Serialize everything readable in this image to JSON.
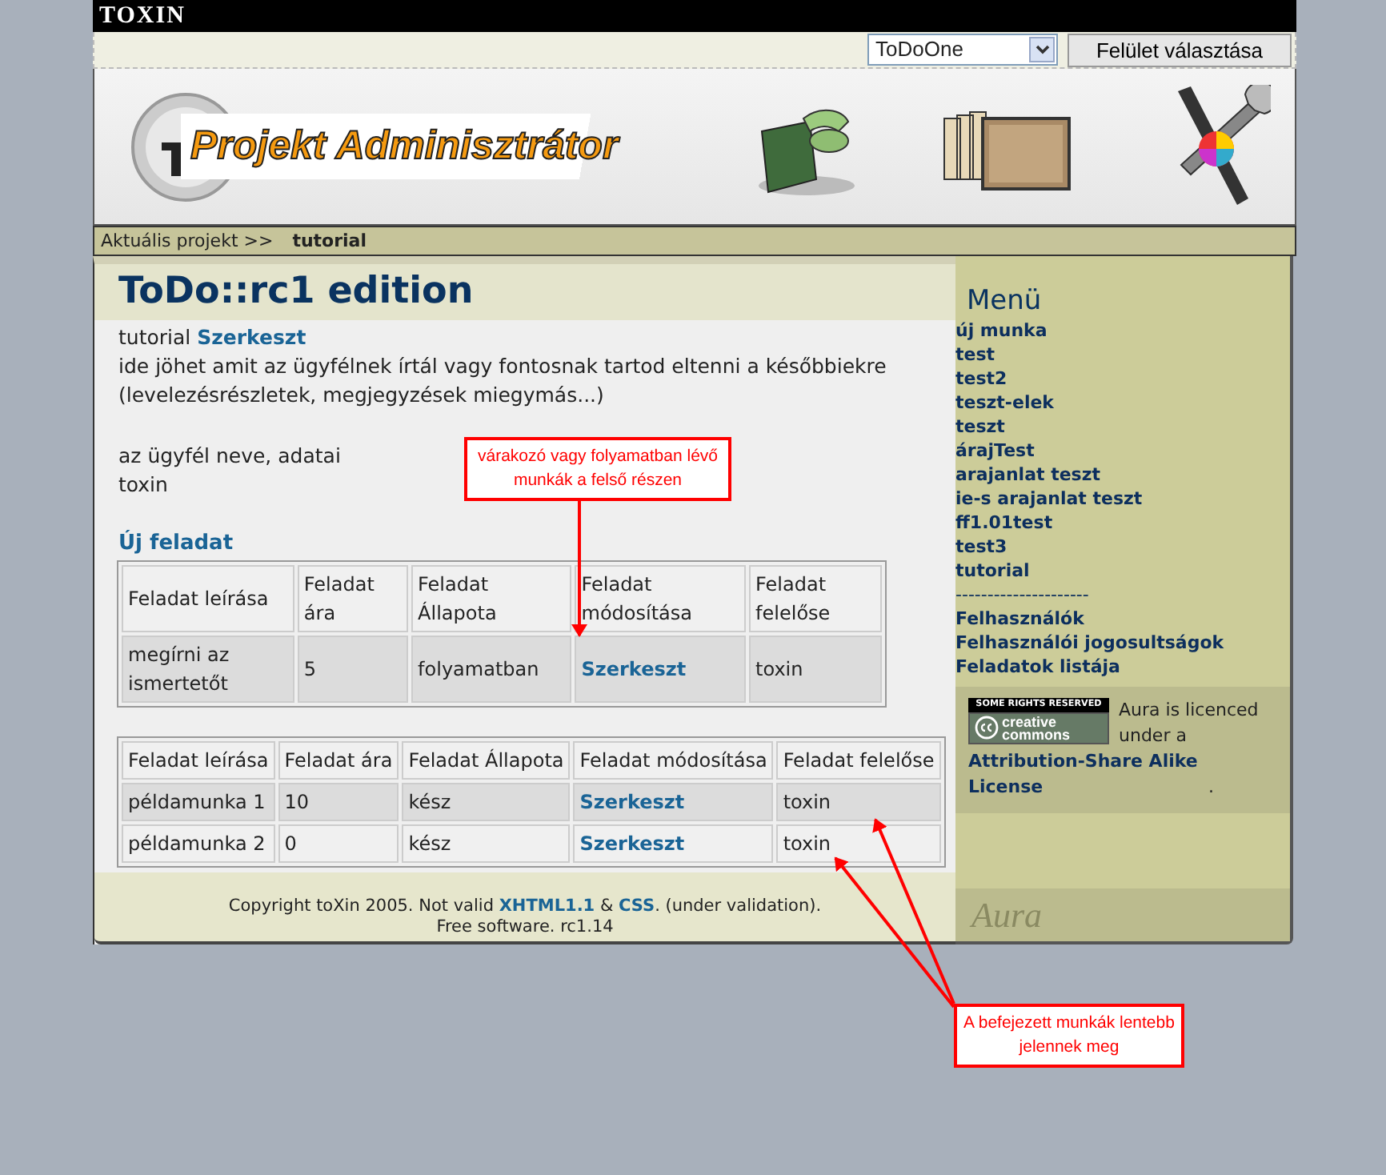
{
  "top_bar": {
    "brand": "TOXIN"
  },
  "theme_selector": {
    "value": "ToDoOne",
    "button": "Felület választása"
  },
  "banner": {
    "logo_text": "Projekt Adminisztrátor"
  },
  "breadcrumb": {
    "label": "Aktuális projekt >>",
    "current": "tutorial"
  },
  "main": {
    "title": "ToDo::rc1 edition",
    "project": "tutorial",
    "edit_link": "Szerkeszt",
    "note": "ide jöhet amit az ügyfélnek írtál vagy fontosnak tartod eltenni a későbbiekre (levelezésrészletek, megjegyzések miegymás...)",
    "client_label": "az ügyfél neve, adatai",
    "client": "toxin",
    "new_task_heading": "Új feladat",
    "tables": [
      {
        "columns": [
          "Feladat leírása",
          "Feladat ára",
          "Feladat Állapota",
          "Feladat módosítása",
          "Feladat felelőse"
        ],
        "rows": [
          {
            "cells": [
              "megírni az ismertetőt",
              "5",
              "folyamatban",
              "Szerkeszt",
              "toxin"
            ]
          }
        ]
      },
      {
        "columns": [
          "Feladat leírása",
          "Feladat ára",
          "Feladat Állapota",
          "Feladat módosítása",
          "Feladat felelőse"
        ],
        "rows": [
          {
            "cells": [
              "példamunka 1",
              "10",
              "kész",
              "Szerkeszt",
              "toxin"
            ]
          },
          {
            "cells": [
              "példamunka 2",
              "0",
              "kész",
              "Szerkeszt",
              "toxin"
            ]
          }
        ]
      }
    ]
  },
  "footer": {
    "line1": [
      {
        "kind": "text",
        "text": "Copyright toXin 2005. Not valid "
      },
      {
        "kind": "link",
        "text": "XHTML1.1"
      },
      {
        "kind": "text",
        "text": " & "
      },
      {
        "kind": "link",
        "text": "CSS"
      },
      {
        "kind": "text",
        "text": ". (under validation)."
      }
    ],
    "line2": "Free software. rc1.14"
  },
  "sidebar": {
    "heading": "Menü",
    "projects": [
      "új munka",
      "test",
      "test2",
      "teszt-elek",
      "teszt",
      "árajTest",
      "arajanlat teszt",
      "ie-s arajanlat teszt",
      "ff1.01test",
      "test3",
      "tutorial"
    ],
    "divider": "---------------------",
    "admin_links": [
      "Felhasználók",
      "Felhasználói jogosultságok",
      "Feladatok listája"
    ],
    "license": {
      "badge_top": "SOME RIGHTS RESERVED",
      "badge_words": [
        "creative",
        "commons"
      ],
      "text": "Aura is licenced under a",
      "link": "Attribution-Share Alike License",
      "after": "."
    },
    "watermark": "Aura"
  },
  "annotations": [
    {
      "lines": [
        "várakozó vagy folyamatban lévő",
        "munkák a felső részen"
      ]
    },
    {
      "lines": [
        "A befejezett munkák lentebb",
        "jelennek meg"
      ]
    }
  ]
}
